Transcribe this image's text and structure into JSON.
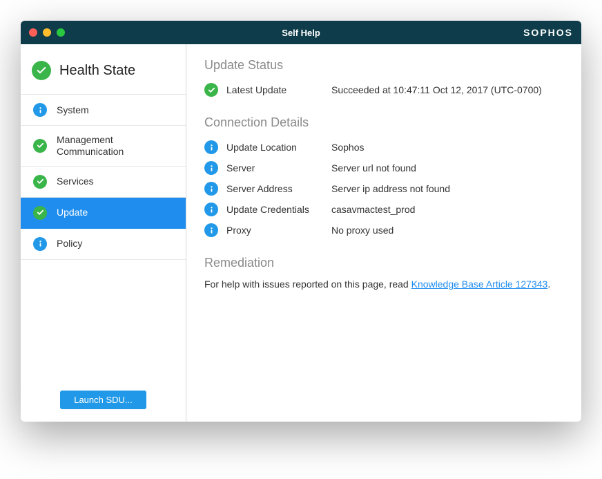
{
  "window": {
    "title": "Self Help",
    "brand": "SOPHOS"
  },
  "sidebar": {
    "health_state_label": "Health State",
    "items": [
      {
        "label": "System",
        "icon": "info"
      },
      {
        "label": "Management Communication",
        "icon": "check"
      },
      {
        "label": "Services",
        "icon": "check"
      },
      {
        "label": "Update",
        "icon": "check",
        "selected": true
      },
      {
        "label": "Policy",
        "icon": "info"
      }
    ],
    "launch_button": "Launch SDU..."
  },
  "content": {
    "update_status": {
      "title": "Update Status",
      "rows": [
        {
          "icon": "check",
          "label": "Latest Update",
          "value": "Succeeded at 10:47:11 Oct 12, 2017 (UTC-0700)"
        }
      ]
    },
    "connection_details": {
      "title": "Connection Details",
      "rows": [
        {
          "icon": "info",
          "label": "Update Location",
          "value": "Sophos"
        },
        {
          "icon": "info",
          "label": "Server",
          "value": "Server url not found"
        },
        {
          "icon": "info",
          "label": "Server Address",
          "value": "Server ip address not found"
        },
        {
          "icon": "info",
          "label": "Update Credentials",
          "value": "casavmactest_prod"
        },
        {
          "icon": "info",
          "label": "Proxy",
          "value": "No proxy used"
        }
      ]
    },
    "remediation": {
      "title": "Remediation",
      "text_before": "For help with issues reported on this page, read ",
      "link_text": "Knowledge Base Article 127343",
      "text_after": "."
    }
  }
}
